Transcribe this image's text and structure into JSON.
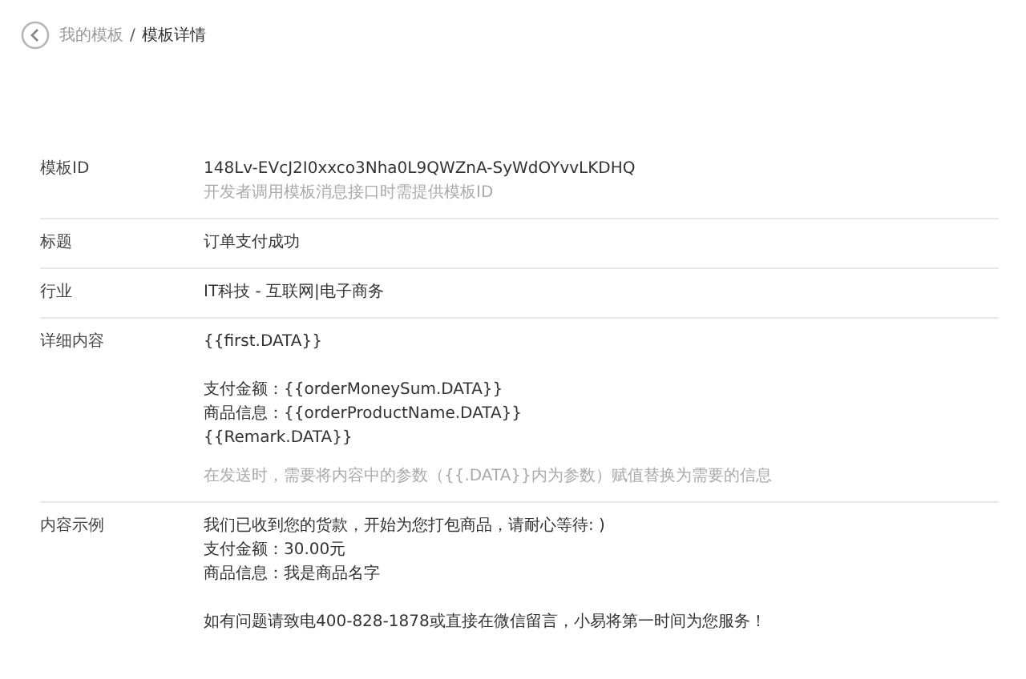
{
  "breadcrumb": {
    "parent": "我的模板",
    "separator": "/",
    "current": "模板详情"
  },
  "rows": [
    {
      "label": "模板ID",
      "paragraphs": [
        [
          "148Lv-EVcJ2I0xxco3Nha0L9QWZnA-SyWdOYvvLKDHQ"
        ]
      ],
      "hint": "开发者调用模板消息接口时需提供模板ID"
    },
    {
      "label": "标题",
      "paragraphs": [
        [
          "订单支付成功"
        ]
      ]
    },
    {
      "label": "行业",
      "paragraphs": [
        [
          "IT科技 - 互联网|电子商务"
        ]
      ]
    },
    {
      "label": "详细内容",
      "paragraphs": [
        [
          "{{first.DATA}}"
        ],
        [
          "支付金额：{{orderMoneySum.DATA}}",
          "商品信息：{{orderProductName.DATA}}",
          "{{Remark.DATA}}"
        ]
      ],
      "hint": "在发送时，需要将内容中的参数（{{.DATA}}内为参数）赋值替换为需要的信息"
    },
    {
      "label": "内容示例",
      "paragraphs": [
        [
          "我们已收到您的货款，开始为您打包商品，请耐心等待: )",
          "支付金额：30.00元",
          "商品信息：我是商品名字"
        ],
        [
          "如有问题请致电400-828-1878或直接在微信留言，小易将第一时间为您服务！"
        ]
      ]
    }
  ]
}
